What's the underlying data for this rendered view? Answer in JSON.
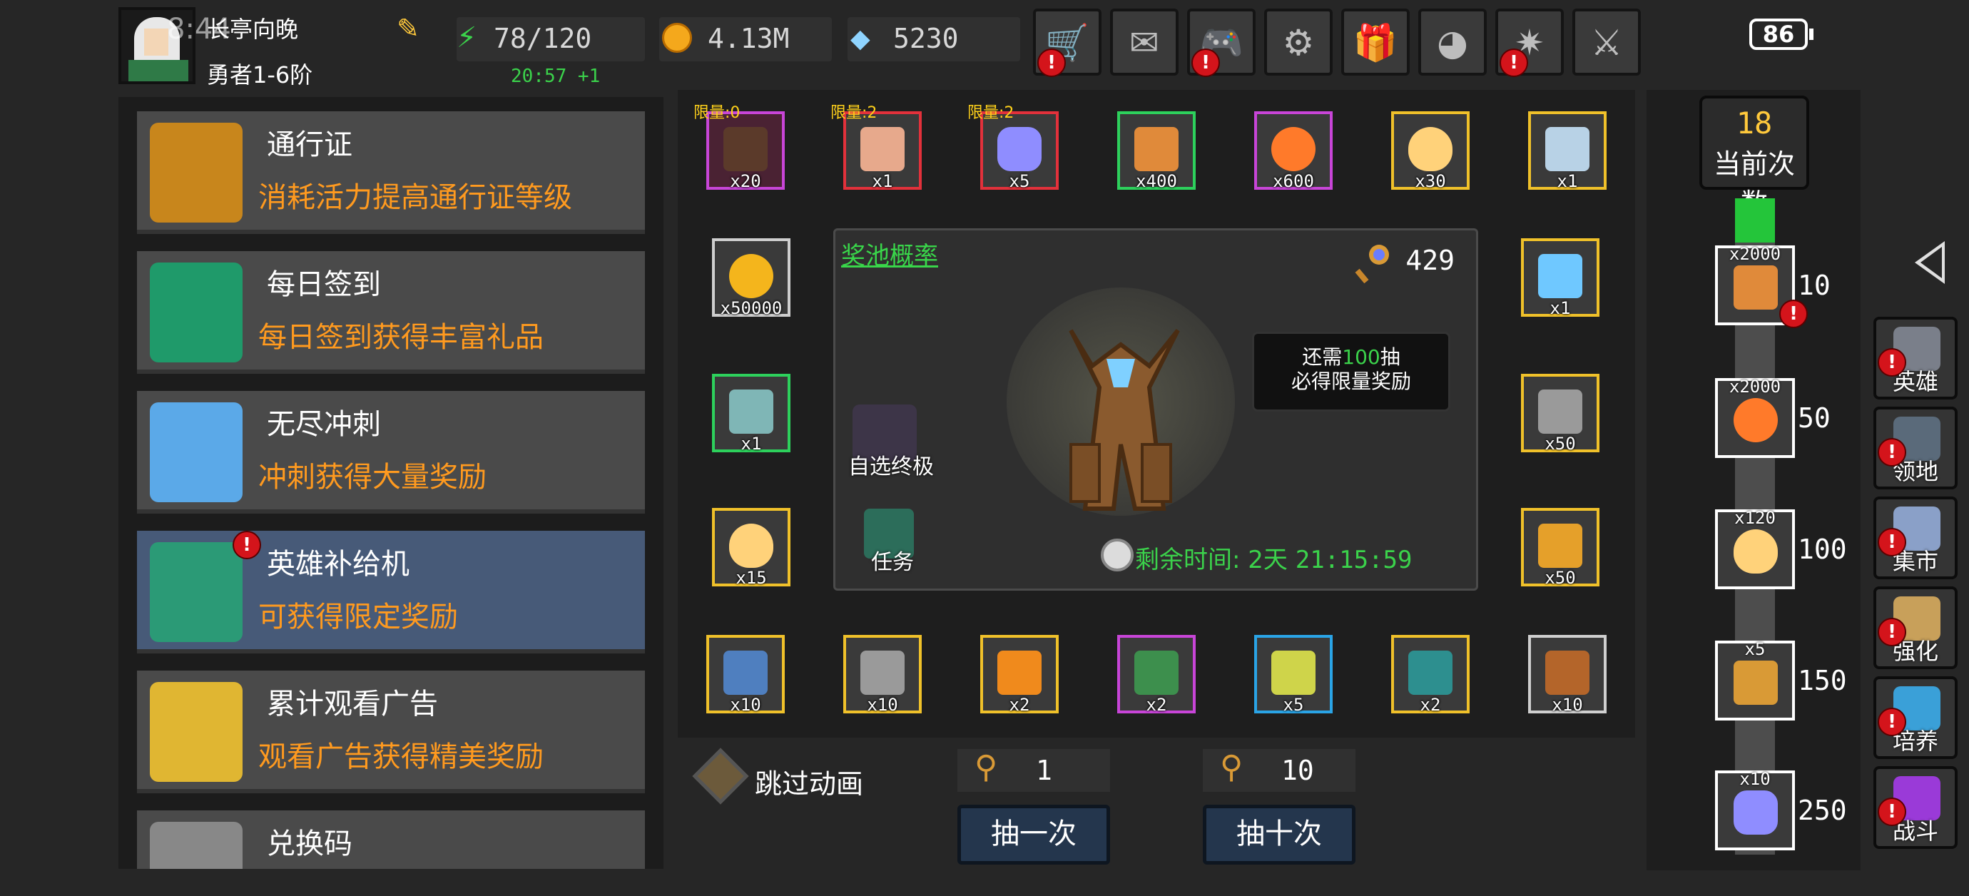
{
  "status": {
    "clock": "8:44",
    "battery": "86"
  },
  "player": {
    "name": "长亭向晚",
    "rank": "勇者1-6阶"
  },
  "resources": {
    "energy": "78/120",
    "energy_timer": "20:57 +1",
    "gold": "4.13M",
    "gems": "5230"
  },
  "top_buttons": [
    {
      "name": "shop",
      "icon": "cart-icon",
      "glyph": "🛒",
      "alert": true
    },
    {
      "name": "mail",
      "icon": "envelope-icon",
      "glyph": "✉",
      "alert": false
    },
    {
      "name": "gamepad",
      "icon": "gamepad-icon",
      "glyph": "🎮",
      "alert": true
    },
    {
      "name": "settings",
      "icon": "gear-icon",
      "glyph": "⚙",
      "alert": false
    },
    {
      "name": "gift",
      "icon": "gift-icon",
      "glyph": "🎁",
      "alert": false
    },
    {
      "name": "gallery",
      "icon": "color-wheel-icon",
      "glyph": "◕",
      "alert": false
    },
    {
      "name": "fireworks",
      "icon": "fireworks-icon",
      "glyph": "✷",
      "alert": true
    },
    {
      "name": "battle",
      "icon": "crossed-swords-icon",
      "glyph": "⚔",
      "alert": false
    }
  ],
  "menu": [
    {
      "title": "通行证",
      "desc": "消耗活力提高通行证等级",
      "icon": "trophy-icon",
      "active": false,
      "alert": false
    },
    {
      "title": "每日签到",
      "desc": "每日签到获得丰富礼品",
      "icon": "book-stack-icon",
      "active": false,
      "alert": false
    },
    {
      "title": "无尽冲刺",
      "desc": "冲刺获得大量奖励",
      "icon": "shield-wings-icon",
      "active": false,
      "alert": false
    },
    {
      "title": "英雄补给机",
      "desc": "可获得限定奖励",
      "icon": "supply-machine-icon",
      "active": true,
      "alert": true
    },
    {
      "title": "累计观看广告",
      "desc": "观看广告获得精美奖励",
      "icon": "treasure-chest-icon",
      "active": false,
      "alert": false
    },
    {
      "title": "兑换码",
      "desc": "",
      "icon": "key-icon",
      "active": false,
      "alert": false
    }
  ],
  "rewards_top": [
    {
      "limit": "限量:0",
      "qty": "x20",
      "rarity": "purple-dark",
      "icon": "treant-icon"
    },
    {
      "limit": "限量:2",
      "qty": "x1",
      "rarity": "red",
      "icon": "pet-cat-icon"
    },
    {
      "limit": "限量:2",
      "qty": "x5",
      "rarity": "red",
      "icon": "star-crystal-icon"
    },
    {
      "limit": "",
      "qty": "x400",
      "rarity": "green",
      "icon": "bone-icon"
    },
    {
      "limit": "",
      "qty": "x600",
      "rarity": "purple",
      "icon": "flame-orb-icon"
    },
    {
      "limit": "",
      "qty": "x30",
      "rarity": "gold",
      "icon": "egg-icon"
    },
    {
      "limit": "",
      "qty": "x1",
      "rarity": "gold",
      "icon": "blade-icon"
    }
  ],
  "rewards_left": [
    {
      "qty": "x50000",
      "rarity": "white",
      "icon": "gold-coin-icon"
    },
    {
      "qty": "x1",
      "rarity": "green",
      "icon": "chest-icon"
    },
    {
      "qty": "x15",
      "rarity": "gold",
      "icon": "egg-icon"
    }
  ],
  "rewards_right": [
    {
      "qty": "x1",
      "rarity": "gold",
      "icon": "mirror-icon"
    },
    {
      "qty": "x50",
      "rarity": "gold",
      "icon": "hammer-icon"
    },
    {
      "qty": "x50",
      "rarity": "gold",
      "icon": "lightning-shard-icon"
    }
  ],
  "rewards_bottom": [
    {
      "qty": "x10",
      "rarity": "gold",
      "icon": "ore-icon"
    },
    {
      "qty": "x10",
      "rarity": "gold",
      "icon": "hammer-icon"
    },
    {
      "qty": "x2",
      "rarity": "gold",
      "icon": "amber-rune-icon"
    },
    {
      "qty": "x2",
      "rarity": "purple",
      "icon": "green-rune-icon"
    },
    {
      "qty": "x5",
      "rarity": "blue",
      "icon": "rune-stone-icon"
    },
    {
      "qty": "x2",
      "rarity": "gold",
      "icon": "spell-book-icon"
    },
    {
      "qty": "x10",
      "rarity": "white",
      "icon": "old-book-icon"
    }
  ],
  "pool": {
    "link": "奖池概率",
    "keys": "429",
    "tip_prefix": "还需",
    "tip_count": "100",
    "tip_suffix": "抽",
    "tip_line2": "必得限量奖励",
    "remain_label": "剩余时间:",
    "remain_days": "2天",
    "remain_time": "21:15:59",
    "auto_label": "自选终极",
    "task_label": "任务"
  },
  "draw": {
    "skip_label": "跳过动画",
    "single_cost": "1",
    "ten_cost": "10",
    "single_label": "抽一次",
    "ten_label": "抽十次"
  },
  "counter": {
    "count": "18",
    "label": "当前次数",
    "milestones": [
      {
        "qty": "x2000",
        "at": "10",
        "rarity": "green",
        "icon": "bone-icon",
        "alert": true
      },
      {
        "qty": "x2000",
        "at": "50",
        "rarity": "purple",
        "icon": "flame-orb-icon",
        "alert": false
      },
      {
        "qty": "x120",
        "at": "100",
        "rarity": "gold",
        "icon": "egg-icon",
        "alert": false
      },
      {
        "qty": "x5",
        "at": "150",
        "rarity": "gold",
        "icon": "key-staff-icon",
        "alert": false
      },
      {
        "qty": "x10",
        "at": "250",
        "rarity": "red",
        "icon": "star-crystal-icon",
        "alert": false
      }
    ]
  },
  "nav": [
    {
      "label": "英雄",
      "icon": "helmet-icon",
      "alert": true
    },
    {
      "label": "领地",
      "icon": "castle-icon",
      "alert": true
    },
    {
      "label": "集市",
      "icon": "market-icon",
      "alert": true
    },
    {
      "label": "强化",
      "icon": "upgrade-icon",
      "alert": true
    },
    {
      "label": "培养",
      "icon": "goblet-icon",
      "alert": true
    },
    {
      "label": "战斗",
      "icon": "portal-icon",
      "alert": true
    }
  ],
  "colors": {
    "accent_orange": "#ff9a1f",
    "accent_green": "#3bd24b",
    "accent_gold": "#ffc93c",
    "alert_red": "#d4141b",
    "active_menu": "#475a78"
  }
}
